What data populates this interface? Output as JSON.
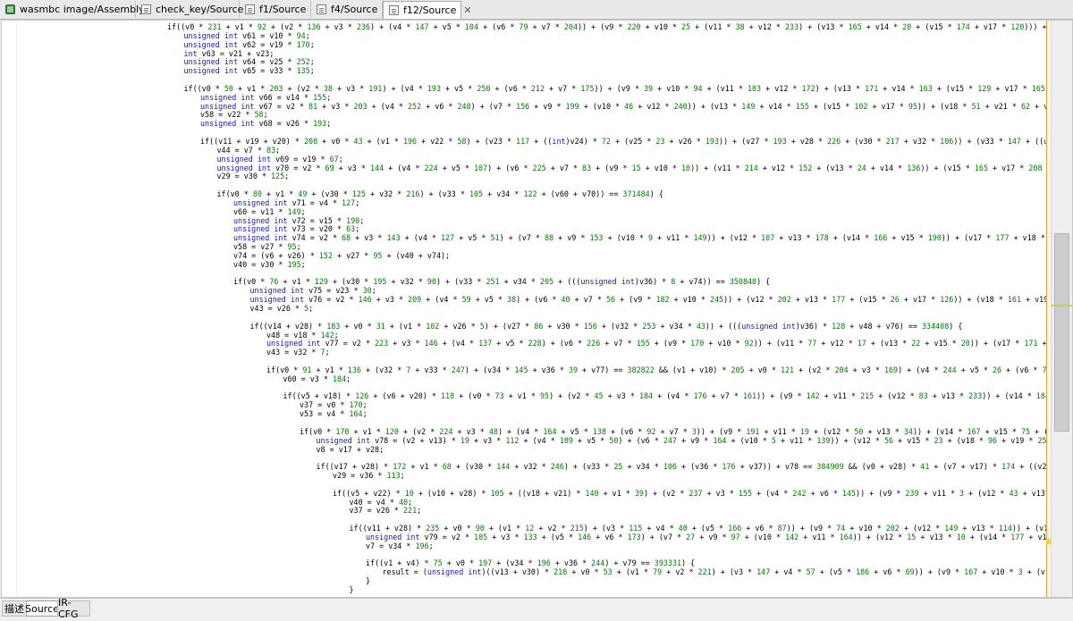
{
  "tabs": [
    {
      "label": "wasmbc image/Assembly",
      "icon": "app-icon"
    },
    {
      "label": "check_key/Source",
      "icon": "document-icon"
    },
    {
      "label": "f1/Source",
      "icon": "document-icon"
    },
    {
      "label": "f4/Source",
      "icon": "document-icon"
    },
    {
      "label": "f12/Source",
      "icon": "document-icon",
      "active": true,
      "close": "✕"
    }
  ],
  "bottom_tabs": [
    {
      "label": "描述"
    },
    {
      "label": "Source",
      "active": true
    },
    {
      "label": "IR-CFG"
    }
  ],
  "code_lines": [
    {
      "indent": 0,
      "text": "if((v0 * 231 + v1 * 92 + (v2 * 136 + v3 * 236) + (v4 * 147 + v5 * 104 + (v6 * 79 + v7 * 204)) + (v9 * 220 + v10 * 25 + (v11 * 38 + v12 * 233) + (v13 * 165 + v14 * 20 + (v15 * 174 + v17 * 120))) + (v18 * 214 + v19 *"
    },
    {
      "indent": 1,
      "text": "unsigned int v61 = v10 * 94;"
    },
    {
      "indent": 1,
      "text": "unsigned int v62 = v19 * 170;"
    },
    {
      "indent": 1,
      "text": "int v63 = v21 + v23;"
    },
    {
      "indent": 1,
      "text": "unsigned int v64 = v25 * 252;"
    },
    {
      "indent": 1,
      "text": "unsigned int v65 = v33 * 135;"
    },
    {
      "indent": 1,
      "text": ""
    },
    {
      "indent": 1,
      "text": "if((v0 * 50 + v1 * 203 + (v2 * 38 + v3 * 191) + (v4 * 193 + v5 * 250 + (v6 * 212 + v7 * 175)) + (v9 * 39 + v10 * 94 + (v11 * 183 + v12 * 172) + (v13 * 171 + v14 * 163 + (v15 * 129 + v17 * 165))) + (v19 * 170 + v2"
    },
    {
      "indent": 2,
      "text": "unsigned int v66 = v14 * 155;"
    },
    {
      "indent": 2,
      "text": "unsigned int v67 = v2 * 81 + v3 * 203 + (v4 * 252 + v6 * 248) + (v7 * 156 + v9 * 199 + (v10 * 46 + v12 * 240)) + (v13 * 149 + v14 * 155 + (v15 * 102 + v17 * 95)) + (v18 * 51 + v21 * 62 + v58));"
    },
    {
      "indent": 2,
      "text": "v58 = v22 * 58;"
    },
    {
      "indent": 2,
      "text": "unsigned int v68 = v26 * 193;"
    },
    {
      "indent": 2,
      "text": ""
    },
    {
      "indent": 2,
      "text": "if((v11 + v19 + v20) * 208 + v0 * 43 + (v1 * 196 + v22 * 58) + (v23 * 117 + ((int)v24) * 72 + (v25 * 23 + v26 * 193)) + (v27 * 193 + v28 * 226 + (v30 * 217 + v32 * 106)) + (v33 * 147 + ((unsigned int)v36) *"
    },
    {
      "indent": 3,
      "text": "v44 = v7 * 83;"
    },
    {
      "indent": 3,
      "text": "unsigned int v69 = v19 * 67;"
    },
    {
      "indent": 3,
      "text": "unsigned int v70 = v2 * 69 + v3 * 144 + (v4 * 224 + v5 * 107) + (v6 * 225 + v7 * 83 + (v9 * 15 + v10 * 10)) + (v11 * 214 + v12 * 152 + (v13 * 24 + v14 * 136)) + (v15 * 165 + v17 * 208 + (v18 * 38 + v19 *"
    },
    {
      "indent": 3,
      "text": "v29 = v30 * 125;"
    },
    {
      "indent": 3,
      "text": ""
    },
    {
      "indent": 3,
      "text": "if(v0 * 80 + v1 * 49 + (v30 * 125 + v32 * 216) + (v33 * 105 + v34 * 122 + (v60 + v70)) == 371484) {"
    },
    {
      "indent": 4,
      "text": "unsigned int v71 = v4 * 127;"
    },
    {
      "indent": 4,
      "text": "v60 = v11 * 149;"
    },
    {
      "indent": 4,
      "text": "unsigned int v72 = v15 * 190;"
    },
    {
      "indent": 4,
      "text": "unsigned int v73 = v20 * 63;"
    },
    {
      "indent": 4,
      "text": "unsigned int v74 = v2 * 68 + v3 * 143 + (v4 * 127 + v5 * 51) + (v7 * 88 + v9 * 153 + (v10 * 9 + v11 * 149)) + (v12 * 107 + v13 * 178 + (v14 * 166 + v15 * 190)) + (v17 * 177 + v18 * 99 + (v19 * 71 + v"
    },
    {
      "indent": 4,
      "text": "v58 = v27 * 95;"
    },
    {
      "indent": 4,
      "text": "v74 = (v6 + v26) * 152 + v27 * 95 + (v40 + v74);"
    },
    {
      "indent": 4,
      "text": "v40 = v30 * 195;"
    },
    {
      "indent": 4,
      "text": ""
    },
    {
      "indent": 4,
      "text": "if(v0 * 76 + v1 * 129 + (v30 * 195 + v32 * 90) + (v33 * 251 + v34 * 205 + (((unsigned int)v36) * 8 + v74)) == 350848) {"
    },
    {
      "indent": 5,
      "text": "unsigned int v75 = v23 * 30;"
    },
    {
      "indent": 5,
      "text": "unsigned int v76 = v2 * 146 + v3 * 209 + (v4 * 59 + v5 * 38) + (v6 * 40 + v7 * 56 + (v9 * 182 + v10 * 245)) + (v12 * 202 + v13 * 177 + (v15 * 26 + v17 * 126)) + (v18 * 161 + v19 * 95 + (v20 * 133"
    },
    {
      "indent": 5,
      "text": "v43 = v26 * 5;"
    },
    {
      "indent": 5,
      "text": ""
    },
    {
      "indent": 5,
      "text": "if((v14 + v28) * 183 + v0 * 31 + (v1 * 102 + v26 * 5) + (v27 * 86 + v30 * 156 + (v32 * 253 + v34 * 43)) + (((unsigned int)v36) * 128 + v48 + v76) == 334408) {"
    },
    {
      "indent": 6,
      "text": "v48 = v18 * 142;"
    },
    {
      "indent": 6,
      "text": "unsigned int v77 = v2 * 223 + v3 * 146 + (v4 * 137 + v5 * 228) + (v6 * 226 + v7 * 155 + (v9 * 170 + v10 * 92)) + (v11 * 77 + v12 * 17 + (v13 * 22 + v15 * 20)) + (v17 * 171 + v18 * 142 + (v20 *"
    },
    {
      "indent": 6,
      "text": "v43 = v32 * 7;"
    },
    {
      "indent": 6,
      "text": ""
    },
    {
      "indent": 6,
      "text": "if(v0 * 91 + v1 * 136 + (v32 * 7 + v33 * 247) + (v34 * 145 + v36 * 39 + v77) == 382822 && (v1 + v10) * 205 + v0 * 121 + (v2 * 204 + v3 * 169) + (v4 * 244 + v5 * 26 + (v6 * 77 + v7 * 134)) +"
    },
    {
      "indent": 7,
      "text": "v60 = v3 * 184;"
    },
    {
      "indent": 7,
      "text": ""
    },
    {
      "indent": 7,
      "text": "if((v5 + v18) * 126 + (v6 + v20) * 118 + (v0 * 73 + v1 * 95) + (v2 * 45 + v3 * 184 + (v4 * 176 + v7 * 161)) + (v9 * 142 + v11 * 215 + (v12 * 83 + v13 * 233)) + (v14 * 184 + v15 * 171 + (v"
    },
    {
      "indent": 8,
      "text": "v37 = v0 * 170;"
    },
    {
      "indent": 8,
      "text": "v53 = v4 * 164;"
    },
    {
      "indent": 8,
      "text": ""
    },
    {
      "indent": 8,
      "text": "if(v0 * 170 + v1 * 120 + (v2 * 224 + v3 * 48) + (v4 * 164 + v5 * 138 + (v6 * 92 + v7 * 3)) + (v9 * 191 + v11 * 19 + (v12 * 50 + v13 * 34)) + (v14 * 167 + v15 * 75 + (v17 * 72 + v18 *"
    },
    {
      "indent": 9,
      "text": "unsigned int v78 = (v2 + v13) * 19 + v3 * 112 + (v4 * 189 + v5 * 50) + (v6 * 247 + v9 * 164 + (v10 * 5 + v11 * 139)) + (v12 * 56 + v15 * 23 + (v18 * 96 + v19 * 254) + (v22 * 149 +"
    },
    {
      "indent": 9,
      "text": "v8 = v17 + v28;"
    },
    {
      "indent": 9,
      "text": ""
    },
    {
      "indent": 9,
      "text": "if((v17 + v28) * 172 + v1 * 68 + (v30 * 144 + v32 * 246) + (v33 * 25 + v34 * 106 + (v36 * 176 + v37)) + v78 == 384909 && (v0 + v28) * 41 + (v7 + v17) * 174 + ((v20 + v23) * 223 +"
    },
    {
      "indent": 10,
      "text": "v29 = v36 * 113;"
    },
    {
      "indent": 10,
      "text": ""
    },
    {
      "indent": 10,
      "text": "if((v5 + v22) * 10 + (v10 + v28) * 105 + ((v18 + v21) * 140 + v1 * 39) + (v2 * 237 + v3 * 155 + (v4 * 242 + v6 * 145)) + (v9 * 239 + v11 * 3 + (v12 * 43 + v13 * 46)) + (v15 *"
    },
    {
      "indent": 11,
      "text": "v40 = v4 * 40;"
    },
    {
      "indent": 11,
      "text": "v37 = v26 * 221;"
    },
    {
      "indent": 11,
      "text": ""
    },
    {
      "indent": 11,
      "text": "if((v11 + v28) * 235 + v0 * 90 + (v1 * 12 + v2 * 215) + (v3 * 115 + v4 * 40 + (v5 * 166 + v6 * 87)) + (v9 * 74 + v10 * 202 + (v12 * 149 + v13 * 114)) + (v14 * 76 + v15 * 2"
    },
    {
      "indent": 12,
      "text": "unsigned int v79 = v2 * 105 + v3 * 133 + (v5 * 146 + v6 * 173) + (v7 * 27 + v9 * 97 + (v10 * 142 + v11 * 164)) + (v12 * 15 + v13 * 10 + (v14 * 177 + v15 * 239)) + (v17"
    },
    {
      "indent": 12,
      "text": "v7 = v34 * 196;"
    },
    {
      "indent": 12,
      "text": ""
    },
    {
      "indent": 12,
      "text": "if((v1 + v4) * 75 + v0 * 197 + (v34 * 196 + v36 * 244) + v79 == 393331) {"
    },
    {
      "indent": 13,
      "text": "result = (unsigned int)((v13 + v30) * 218 + v0 * 53 + (v1 * 79 + v2 * 221) + (v3 * 147 + v4 * 57 + (v5 * 186 + v6 * 69)) + (v9 * 167 + v10 * 3 + (v11 * 220 + v12"
    },
    {
      "indent": 12,
      "text": "}"
    },
    {
      "indent": 11,
      "text": "}"
    }
  ]
}
